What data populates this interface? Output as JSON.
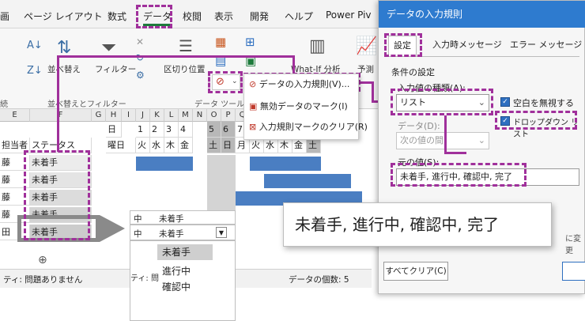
{
  "ribbon": {
    "tabs": [
      "画",
      "ページ レイアウト",
      "数式",
      "データ",
      "校閲",
      "表示",
      "開発",
      "ヘルプ",
      "Power Piv"
    ],
    "active_tab": "データ",
    "sort_label": "並べ替え",
    "filter_label": "フィルター",
    "sort_filter_group": "並べ替えとフィルター",
    "text_to_columns_label": "区切り位置",
    "whatif_label": "What-If 分析",
    "forecast_label": "予測",
    "data_tools_group": "データ ツール",
    "left_group": "続"
  },
  "dv_menu": {
    "items": [
      "データの入力規則(V)...",
      "無効データのマーク(I)",
      "入力規則マークのクリア(R)"
    ]
  },
  "sheet": {
    "columns": [
      "E",
      "F",
      "G",
      "H",
      "I",
      "J",
      "K",
      "L",
      "M",
      "N",
      "O",
      "P",
      "Q",
      "R"
    ],
    "day_labels": [
      "日",
      "1",
      "2",
      "3",
      "4",
      "5",
      "6",
      "7"
    ],
    "weekday_labels": [
      "曜日",
      "火",
      "水",
      "木",
      "金",
      "土",
      "日",
      "月",
      "火",
      "水",
      "木",
      "金",
      "土"
    ],
    "owner_col": [
      "担当者",
      "藤",
      "藤",
      "藤",
      "藤",
      "田"
    ],
    "status_header": "ステータス",
    "status_values": [
      "未着手",
      "未着手",
      "未着手",
      "未着手",
      "未着手"
    ],
    "sheet_add": "⊕",
    "status_text": "ティ: 問題ありません",
    "count_text": "データの個数: 5"
  },
  "inline_list": {
    "row1_a": "中",
    "row1_b": "未着手",
    "row2_a": "中",
    "row2_b": "未着手",
    "items": [
      "未着手",
      "進行中",
      "確認中"
    ],
    "status": "ティ: 問"
  },
  "dialog": {
    "title": "データの入力規則",
    "tabs": [
      "設定",
      "入力時メッセージ",
      "エラー メッセージ"
    ],
    "conditions_label": "条件の設定",
    "allow_label": "入力値の種類(A):",
    "allow_value": "リスト",
    "ignore_blank": "空白を無視する",
    "dropdown_option": "ドロップダウン リスト",
    "data_label": "データ(D):",
    "data_value": "次の値の間",
    "source_label": "元の値(S):",
    "source_value": "未着手, 進行中, 確認中, 完了",
    "clear_all": "すべてクリア(C)",
    "partial_text": "に変更"
  },
  "callout": {
    "text": "未着手, 進行中, 確認中, 完了"
  },
  "colors": {
    "accent_purple": "#a0309b",
    "excel_blue": "#4a7ec2",
    "dialog_title": "#2e7bcf"
  }
}
